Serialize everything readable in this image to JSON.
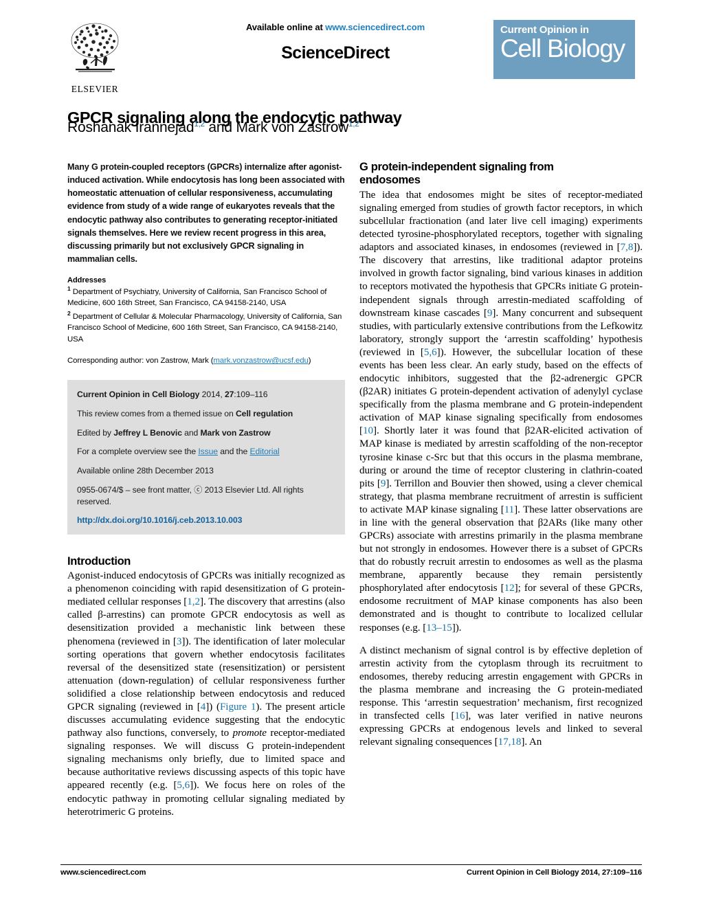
{
  "masthead": {
    "publisher_name": "ELSEVIER",
    "available_online_prefix": "Available online at ",
    "available_online_url": "www.sciencedirect.com",
    "platform_name_part1": "Science",
    "platform_name_part2": "Direct",
    "journal_logo_line1": "Current Opinion in",
    "journal_logo_line2": "Cell Biology",
    "journal_logo_color": "#6e9fc0",
    "link_color": "#1f7fc0"
  },
  "article": {
    "title": "GPCR signaling along the endocytic pathway",
    "authors_prefix": "Roshanak Irannejad",
    "author1_affil": "1,2",
    "authors_conjunction": " and Mark von Zastrow",
    "author2_affil": "1,2"
  },
  "abstract": {
    "text": "Many G protein-coupled receptors (GPCRs) internalize after agonist-induced activation. While endocytosis has long been associated with homeostatic attenuation of cellular responsiveness, accumulating evidence from study of a wide range of eukaryotes reveals that the endocytic pathway also contributes to generating receptor-initiated signals themselves. Here we review recent progress in this area, discussing primarily but not exclusively GPCR signaling in mammalian cells."
  },
  "addresses": {
    "heading": "Addresses",
    "affil1_marker": "1",
    "affil1_text": "Department of Psychiatry, University of California, San Francisco School of Medicine, 600 16th Street, San Francisco, CA 94158-2140, USA",
    "affil2_marker": "2",
    "affil2_text": "Department of Cellular & Molecular Pharmacology, University of California, San Francisco School of Medicine, 600 16th Street, San Francisco, CA 94158-2140, USA",
    "corresponding_prefix": "Corresponding author: von Zastrow, Mark (",
    "corresponding_email": "mark.vonzastrow@ucsf.edu",
    "corresponding_suffix": ")"
  },
  "meta_box": {
    "citation_journal": "Current Opinion in Cell Biology",
    "citation_rest_pre": " 2014, ",
    "citation_volume": "27",
    "citation_pages": ":109–116",
    "themed_prefix": "This review comes from a themed issue on ",
    "themed_issue": "Cell regulation",
    "edited_prefix": "Edited by ",
    "editor1": "Jeffrey L Benovic",
    "edited_conj": " and ",
    "editor2": "Mark von Zastrow",
    "overview_prefix": "For a complete overview see the ",
    "overview_link1": "Issue",
    "overview_mid": " and the ",
    "overview_link2": "Editorial",
    "available_online": "Available online 28th December 2013",
    "front_matter": "0955-0674/$ – see front matter, ⓒ 2013 Elsevier Ltd. All rights reserved.",
    "doi": "http://dx.doi.org/10.1016/j.ceb.2013.10.003"
  },
  "sections": {
    "introduction": {
      "heading": "Introduction",
      "para1_a": "Agonist-induced endocytosis of GPCRs was initially recognized as a phenomenon coinciding with rapid desensitization of G protein-mediated cellular responses [",
      "para1_ref1": "1,2",
      "para1_b": "]. The discovery that arrestins (also called β-arrestins) can promote GPCR endocytosis as well as desensitization provided a mechanistic link between these phenomena (reviewed in [",
      "para1_ref2": "3",
      "para1_c": "]). The identification of later molecular sorting operations that govern whether endocytosis facilitates reversal of the desensitized state (resensitization) or persistent attenuation (down-regulation) of cellular responsiveness further solidified a close relationship between endocytosis and reduced GPCR signaling (reviewed in [",
      "para1_ref3": "4",
      "para1_d": "]) (",
      "para1_figref": "Figure 1",
      "para1_e": "). The present article discusses accumulating evidence suggesting that the endocytic pathway also functions, conversely, to ",
      "para1_italic": "promote",
      "para1_f": " receptor-mediated signaling responses. We will discuss G protein-independent signaling mechanisms only briefly, due to limited space and because authoritative reviews discussing aspects of this topic have appeared recently (e.g. [",
      "para1_ref4": "5,6",
      "para1_g": "]). We focus here on roles of the endocytic pathway in promoting cellular signaling mediated by heterotrimeric G proteins."
    },
    "g_protein_independent": {
      "heading_line1": "G protein-independent signaling from",
      "heading_line2": "endosomes",
      "para1_a": "The idea that endosomes might be sites of receptor-mediated signaling emerged from studies of growth factor receptors, in which subcellular fractionation (and later live cell imaging) experiments detected tyrosine-phosphorylated receptors, together with signaling adaptors and associated kinases, in endosomes (reviewed in [",
      "para1_ref1": "7,8",
      "para1_b": "]). The discovery that arrestins, like traditional adaptor proteins involved in growth factor signaling, bind various kinases in addition to receptors motivated the hypothesis that GPCRs initiate G protein-independent signals through arrestin-mediated scaffolding of downstream kinase cascades [",
      "para1_ref2": "9",
      "para1_c": "]. Many concurrent and subsequent studies, with particularly extensive contributions from the Lefkowitz laboratory, strongly support the ‘arrestin scaffolding’ hypothesis (reviewed in [",
      "para1_ref3": "5,6",
      "para1_d": "]). However, the subcellular location of these events has been less clear. An early study, based on the effects of endocytic inhibitors, suggested that the β2-adrenergic GPCR (β2AR) initiates G protein-dependent activation of adenylyl cyclase specifically from the plasma membrane and G protein-independent activation of MAP kinase signaling specifically from endosomes [",
      "para1_ref4": "10",
      "para1_e": "]. Shortly later it was found that β2AR-elicited activation of MAP kinase is mediated by arrestin scaffolding of the non-receptor tyrosine kinase c-Src but that this occurs in the plasma membrane, during or around the time of receptor clustering in clathrin-coated pits [",
      "para1_ref5": "9",
      "para1_f": "]. Terrillon and Bouvier then showed, using a clever chemical strategy, that plasma membrane recruitment of arrestin is sufficient to activate MAP kinase signaling [",
      "para1_ref6": "11",
      "para1_g": "]. These latter observations are in line with the general observation that β2ARs (like many other GPCRs) associate with arrestins primarily in the plasma membrane but not strongly in endosomes. However there is a subset of GPCRs that do robustly recruit arrestin to endosomes as well as the plasma membrane, apparently because they remain persistently phosphorylated after endocytosis [",
      "para1_ref7": "12",
      "para1_h": "]; for several of these GPCRs, endosome recruitment of MAP kinase components has also been demonstrated and is thought to contribute to localized cellular responses (e.g. [",
      "para1_ref8": "13–15",
      "para1_i": "]).",
      "para2_a": "A distinct mechanism of signal control is by effective depletion of arrestin activity from the cytoplasm through its recruitment to endosomes, thereby reducing arrestin engagement with GPCRs in the plasma membrane and increasing the G protein-mediated response. This ‘arrestin sequestration’ mechanism, first recognized in transfected cells [",
      "para2_ref1": "16",
      "para2_b": "], was later verified in native neurons expressing GPCRs at endogenous levels and linked to several relevant signaling consequences [",
      "para2_ref2": "17,18",
      "para2_c": "]. An"
    }
  },
  "footer": {
    "left": "www.sciencedirect.com",
    "right_journal": "Current Opinion in Cell Biology",
    "right_rest": " 2014, 27:109–116"
  }
}
